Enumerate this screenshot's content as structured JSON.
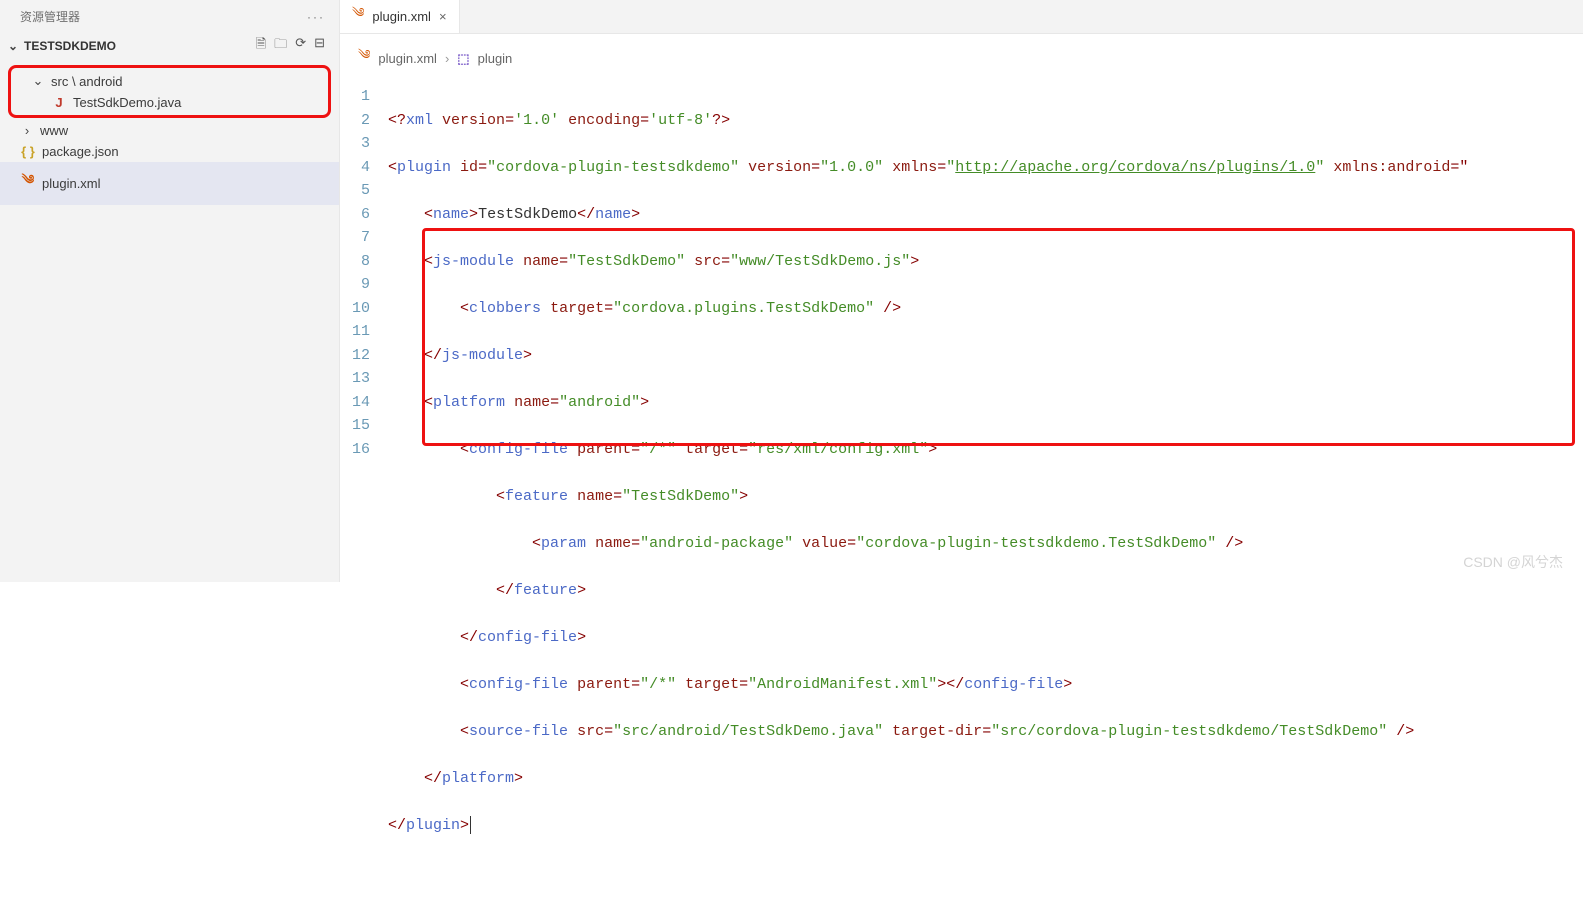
{
  "sidebar": {
    "title": "资源管理器",
    "project": "TESTSDKDEMO",
    "actionIcons": [
      "new-file",
      "new-folder",
      "refresh",
      "collapse"
    ],
    "tree": {
      "folder1": {
        "label": "src \\ android",
        "expanded": true
      },
      "file1": {
        "label": "TestSdkDemo.java",
        "icon": "J"
      },
      "folder2": {
        "label": "www",
        "expanded": false
      },
      "file2": {
        "label": "package.json",
        "icon": "{ }"
      },
      "file3": {
        "label": "plugin.xml",
        "icon": "rss"
      }
    }
  },
  "tab": {
    "label": "plugin.xml"
  },
  "breadcrumb": {
    "file": "plugin.xml",
    "node": "plugin"
  },
  "code": {
    "lineCount": 16,
    "l1": {
      "preamble": "<?",
      "xml": "xml",
      "sp": " ",
      "verAttr": "version",
      "eq": "=",
      "verVal": "'1.0'",
      "encAttr": "encoding",
      "encVal": "'utf-8'",
      "end": "?>"
    },
    "l2": {
      "open": "<",
      "tag": "plugin",
      "idAttr": "id",
      "idVal": "\"cordova-plugin-testsdkdemo\"",
      "verAttr": "version",
      "verVal": "\"1.0.0\"",
      "nsAttr": "xmlns",
      "nsVal": "http://apache.org/cordova/ns/plugins/1.0",
      "nsaAttr": "xmlns:android",
      "tail": "=\""
    },
    "l3": {
      "open": "<",
      "tag": "name",
      "text": "TestSdkDemo",
      "close": "</",
      "closeTag": "name",
      "end": ">"
    },
    "l4": {
      "open": "<",
      "tag": "js-module",
      "nameAttr": "name",
      "nameVal": "\"TestSdkDemo\"",
      "srcAttr": "src",
      "srcVal": "\"www/TestSdkDemo.js\"",
      "end": ">"
    },
    "l5": {
      "open": "<",
      "tag": "clobbers",
      "tgtAttr": "target",
      "tgtVal": "\"cordova.plugins.TestSdkDemo\"",
      "end": " />"
    },
    "l6": {
      "close": "</",
      "tag": "js-module",
      "end": ">"
    },
    "l7": {
      "open": "<",
      "tag": "platform",
      "nameAttr": "name",
      "nameVal": "\"android\"",
      "end": ">"
    },
    "l8": {
      "open": "<",
      "tag": "config-file",
      "parAttr": "parent",
      "parVal": "\"/*\"",
      "tgtAttr": "target",
      "tgtVal": "\"res/xml/config.xml\"",
      "end": ">"
    },
    "l9": {
      "open": "<",
      "tag": "feature",
      "nameAttr": "name",
      "nameVal": "\"TestSdkDemo\"",
      "end": ">"
    },
    "l10": {
      "open": "<",
      "tag": "param",
      "nameAttr": "name",
      "nameVal": "\"android-package\"",
      "valAttr": "value",
      "valVal": "\"cordova-plugin-testsdkdemo.TestSdkDemo\"",
      "end": " />"
    },
    "l11": {
      "close": "</",
      "tag": "feature",
      "end": ">"
    },
    "l12": {
      "close": "</",
      "tag": "config-file",
      "end": ">"
    },
    "l13": {
      "open": "<",
      "tag": "config-file",
      "parAttr": "parent",
      "parVal": "\"/*\"",
      "tgtAttr": "target",
      "tgtVal": "\"AndroidManifest.xml\"",
      "mid": "></",
      "closeTag": "config-file",
      "end": ">"
    },
    "l14": {
      "open": "<",
      "tag": "source-file",
      "srcAttr": "src",
      "srcVal": "\"src/android/TestSdkDemo.java\"",
      "tdAttr": "target-dir",
      "tdVal": "\"src/cordova-plugin-testsdkdemo/TestSdkDemo\"",
      "end": " />"
    },
    "l15": {
      "close": "</",
      "tag": "platform",
      "end": ">"
    },
    "l16": {
      "close": "</",
      "tag": "plugin",
      "end": ">"
    }
  },
  "watermark": "CSDN @风兮杰"
}
